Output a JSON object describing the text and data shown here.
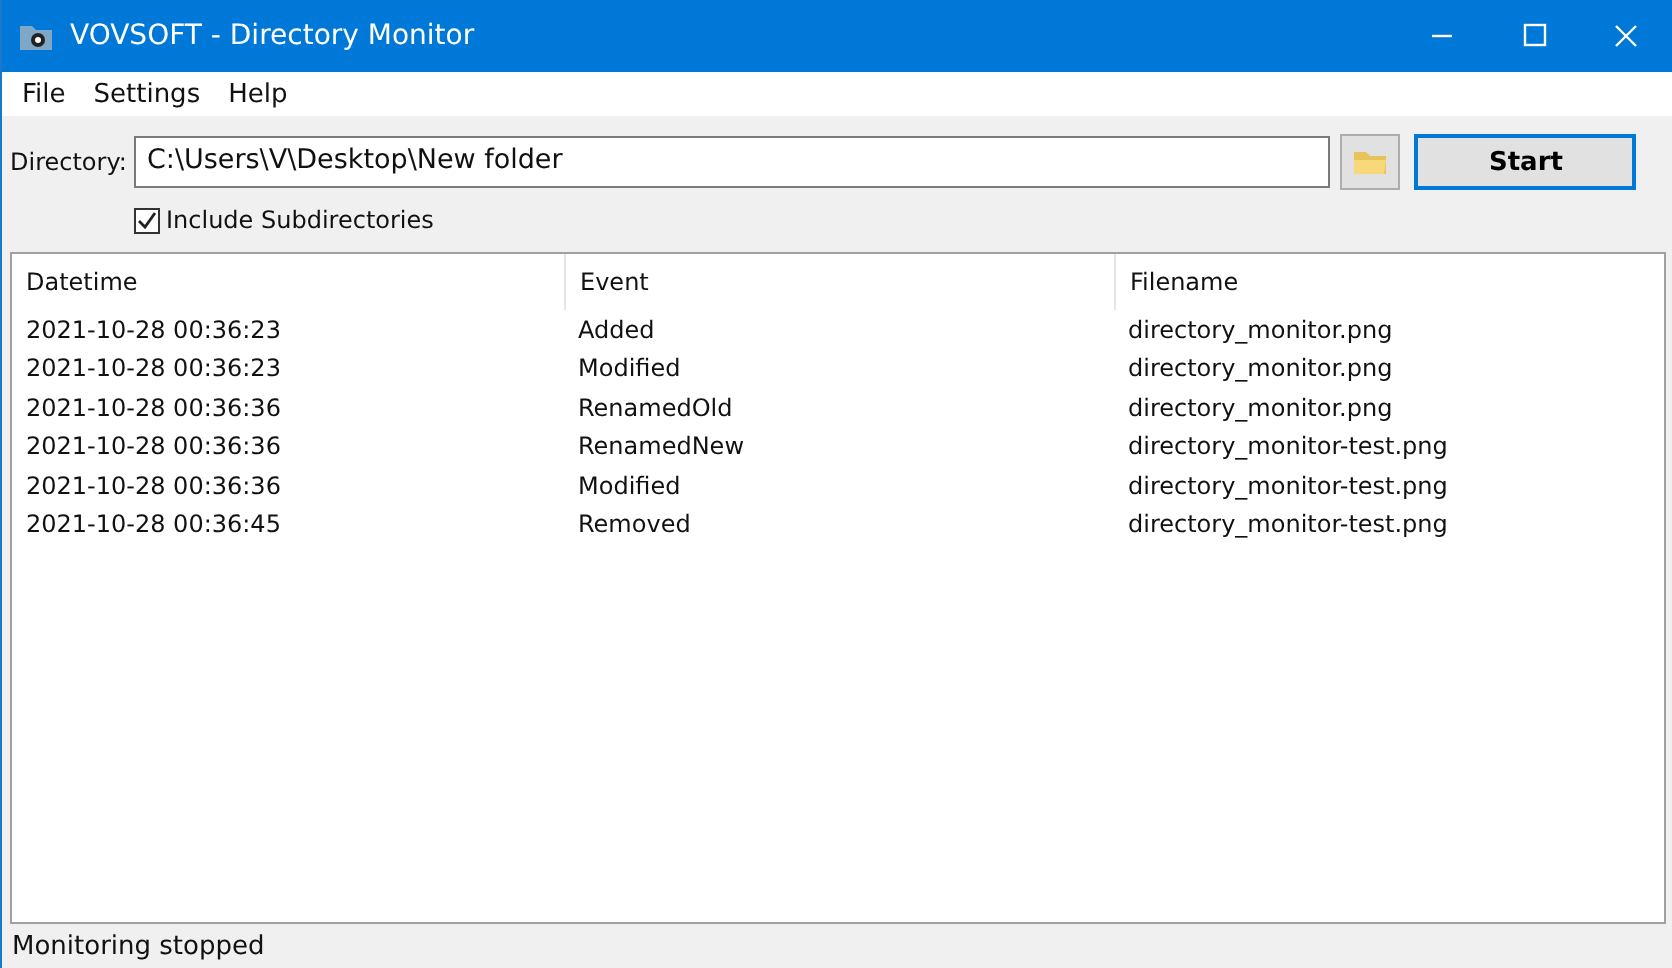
{
  "window": {
    "title": "VOVSOFT - Directory Monitor"
  },
  "menu": [
    "File",
    "Settings",
    "Help"
  ],
  "directory": {
    "label": "Directory:",
    "value": "C:\\Users\\V\\Desktop\\New folder"
  },
  "start_button": "Start",
  "include_subdirectories": {
    "label": "Include Subdirectories",
    "checked": true
  },
  "table": {
    "columns": [
      "Datetime",
      "Event",
      "Filename"
    ],
    "rows": [
      [
        "2021-10-28 00:36:23",
        "Added",
        "directory_monitor.png"
      ],
      [
        "2021-10-28 00:36:23",
        "Modified",
        "directory_monitor.png"
      ],
      [
        "2021-10-28 00:36:36",
        "RenamedOld",
        "directory_monitor.png"
      ],
      [
        "2021-10-28 00:36:36",
        "RenamedNew",
        "directory_monitor-test.png"
      ],
      [
        "2021-10-28 00:36:36",
        "Modified",
        "directory_monitor-test.png"
      ],
      [
        "2021-10-28 00:36:45",
        "Removed",
        "directory_monitor-test.png"
      ]
    ]
  },
  "status_bar": "Monitoring stopped"
}
